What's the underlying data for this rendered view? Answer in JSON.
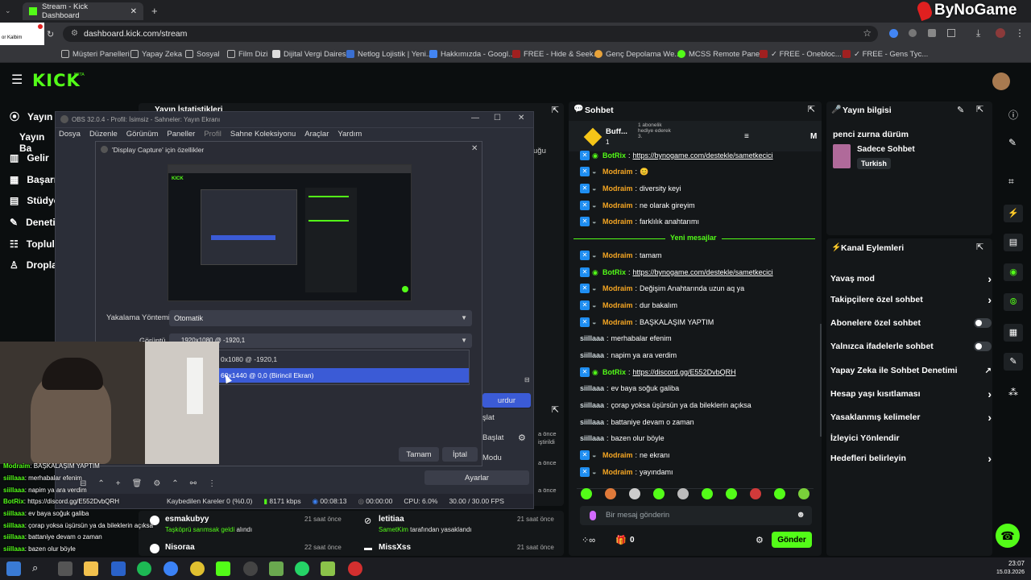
{
  "browser": {
    "tab_title": "Stream - Kick Dashboard",
    "url": "dashboard.kick.com/stream",
    "bookmarks": [
      "Müşteri Panelleri",
      "Yapay Zeka",
      "Sosyal",
      "Film Dizi",
      "Dijital Vergi Dairesi",
      "Netlog Lojistik | Yeni...",
      "Hakkımızda - Googl...",
      "FREE - Hide & Seek...",
      "Genç Depolama We...",
      "MCSS Remote Panel...",
      "✓ FREE - Onebloc...",
      "✓ FREE - Gens Tyc..."
    ]
  },
  "watermark": "ByNoGame",
  "kick": {
    "logo": "KICK",
    "beta": "BETA",
    "sidebar": [
      "Yayın",
      "Yayın Ba",
      "Gelir",
      "Başarı",
      "Stüdyo",
      "Deneti",
      "Topluli",
      "Dropla"
    ],
    "stats_title": "Yayın İstatistikleri",
    "bg_text": "uğu",
    "chat": {
      "title": "Sohbet",
      "pinned_user": "Buff...",
      "pinned_count": "1",
      "pinned_note": "1 abonelik hediye ederek 3.",
      "pinned_m": "M",
      "new_messages": "Yeni mesajlar",
      "messages": [
        {
          "user": "BotRix",
          "text": "https://bynogame.com/destekle/sametkecici",
          "kind": "bot"
        },
        {
          "user": "Modraim",
          "text": "😊",
          "kind": "mod"
        },
        {
          "user": "Modraim",
          "text": "diversity keyi",
          "kind": "mod"
        },
        {
          "user": "Modraim",
          "text": "ne olarak gireyim",
          "kind": "mod"
        },
        {
          "user": "Modraim",
          "text": "farklılık anahtarımı",
          "kind": "mod"
        },
        {
          "user": "Modraim",
          "text": "tamam",
          "kind": "mod"
        },
        {
          "user": "BotRix",
          "text": "https://bynogame.com/destekle/sametkecici",
          "kind": "bot"
        },
        {
          "user": "Modraim",
          "text": "Değişim Anahtarında uzun aq ya",
          "kind": "mod"
        },
        {
          "user": "Modraim",
          "text": "dur bakalım",
          "kind": "mod"
        },
        {
          "user": "Modraim",
          "text": "BAŞKALAŞIM YAPTIM",
          "kind": "mod"
        },
        {
          "user": "siillaaa",
          "text": "merhabalar efenim",
          "kind": "user"
        },
        {
          "user": "siillaaa",
          "text": "napim ya ara verdim",
          "kind": "user"
        },
        {
          "user": "BotRix",
          "text": "https://discord.gg/E552DvbQRH",
          "kind": "bot"
        },
        {
          "user": "siillaaa",
          "text": "ev baya soğuk galiba",
          "kind": "user"
        },
        {
          "user": "siillaaa",
          "text": "çorap yoksa üşürsün ya da bileklerin açıksa",
          "kind": "user"
        },
        {
          "user": "siillaaa",
          "text": "battaniye devam o zaman",
          "kind": "user"
        },
        {
          "user": "siillaaa",
          "text": "bazen olur böyle",
          "kind": "user"
        },
        {
          "user": "Modraim",
          "text": "ne ekranı",
          "kind": "mod"
        },
        {
          "user": "Modraim",
          "text": "yayındamı",
          "kind": "mod"
        }
      ],
      "input_placeholder": "Bir mesaj gönderin",
      "points": "0",
      "send": "Gönder"
    },
    "info": {
      "title": "Yayın bilgisi",
      "stream_title": "penci zurna dürüm",
      "category": "Sadece Sohbet",
      "language": "Turkish"
    },
    "actions": {
      "title": "Kanal Eylemleri",
      "items": [
        "Yavaş mod",
        "Takipçilere özel sohbet",
        "Abonelere özel sohbet",
        "Yalnızca ifadelerle sohbet",
        "Yapay Zeka ile Sohbet Denetimi",
        "Hesap yaşı kısıtlaması",
        "Yasaklanmış kelimeler",
        "İzleyici Yönlendir",
        "Hedefleri belirleyin"
      ]
    },
    "activity": [
      {
        "user": "esmakubyy",
        "action": "Taşköprü sarımsak geldi",
        "suffix": "alındı",
        "time": "21 saat önce"
      },
      {
        "user": "Nisoraa",
        "action": "",
        "suffix": "",
        "time": "22 saat önce"
      },
      {
        "user": "letitiaa",
        "action": "SametKim",
        "suffix": "tarafından yasaklandı",
        "time": "21 saat önce"
      },
      {
        "user": "MissXss",
        "action": "",
        "suffix": "",
        "time": "21 saat önce"
      }
    ],
    "times_right": [
      "a önce",
      "a önce",
      "a önce",
      "iştirildi"
    ]
  },
  "obs": {
    "title": "OBS 32.0.4 - Profil: İsimsiz - Sahneler: Yayın Ekranı",
    "menu": [
      "Dosya",
      "Düzenle",
      "Görünüm",
      "Paneller",
      "Profil",
      "Sahne Koleksiyonu",
      "Araçlar",
      "Yardım"
    ],
    "dialog_title": "'Display Capture' için özellikler",
    "capture_label": "Yakalama Yöntemi",
    "capture_value": "Otomatik",
    "display_label": "Görüntü",
    "display_value": "... 1920x1080 @ -1920,1",
    "options": [
      "0x1080 @ -1920,1",
      "60x1440 @ 0,0 (Birincil Ekran)"
    ],
    "ok": "Tamam",
    "cancel": "İptal",
    "ctrl_buttons": [
      "urdur",
      "şlat",
      "Başlat",
      "Modu",
      "Ayarlar"
    ],
    "status": {
      "dropped": "Kaybedilen Kareler 0 (%0.0)",
      "bitrate": "8171 kbps",
      "time1": "00:08:13",
      "time2": "00:00:00",
      "cpu": "CPU: 6.0%",
      "fps": "30.00 / 30.00 FPS"
    }
  },
  "webcam_chat": [
    {
      "user": "Modraim",
      "text": "BAŞKALAŞIM YAPTIM"
    },
    {
      "user": "siillaaa",
      "text": "merhabalar efenim"
    },
    {
      "user": "siillaaa",
      "text": "napim ya ara verdim"
    },
    {
      "user": "BotRix",
      "text": "https://discord.gg/E552DvbQRH"
    },
    {
      "user": "siillaaa",
      "text": "ev baya soğuk galiba"
    },
    {
      "user": "siillaaa",
      "text": "çorap yoksa üşürsün ya da bileklerin açıksa"
    },
    {
      "user": "siillaaa",
      "text": "battaniye devam o zaman"
    },
    {
      "user": "siillaaa",
      "text": "bazen olur böyle"
    },
    {
      "user": "Modraim",
      "text": "ne ekranı"
    }
  ],
  "mini_popup": {
    "text": "or Kalbim",
    "time": "02:03"
  },
  "taskbar": {
    "time": "23:07",
    "date": "15.03.2026"
  }
}
